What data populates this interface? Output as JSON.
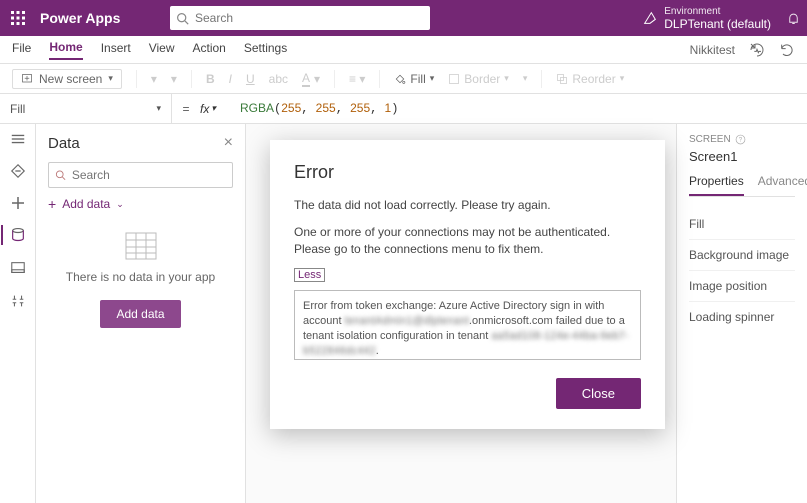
{
  "topbar": {
    "brand": "Power Apps",
    "search_placeholder": "Search",
    "env_label": "Environment",
    "env_name": "DLPTenant (default)"
  },
  "tabs": {
    "items": [
      "File",
      "Home",
      "Insert",
      "View",
      "Action",
      "Settings"
    ],
    "active": "Home",
    "user": "Nikkitest"
  },
  "toolbar": {
    "new_screen": "New screen",
    "fill": "Fill",
    "border": "Border",
    "reorder": "Reorder"
  },
  "fx": {
    "property": "Fill",
    "fx_label": "fx",
    "fn": "RGBA",
    "args": [
      "255",
      "255",
      "255",
      "1"
    ]
  },
  "datapanel": {
    "title": "Data",
    "search_placeholder": "Search",
    "add_link": "Add data",
    "empty_msg": "There is no data in your app",
    "add_btn": "Add data"
  },
  "inspector": {
    "section": "SCREEN",
    "name": "Screen1",
    "tabs": [
      "Properties",
      "Advanced"
    ],
    "props": [
      "Fill",
      "Background image",
      "Image position",
      "Loading spinner"
    ]
  },
  "modal": {
    "title": "Error",
    "line1": "The data did not load correctly. Please try again.",
    "line2": "One or more of your connections may not be authenticated. Please go to the connections menu to fix them.",
    "less": "Less",
    "detail_pre": "Error from token exchange: Azure Active Directory sign in with account ",
    "detail_red1": "tenantAdmin1@dlptenant",
    "detail_mid": ".onmicrosoft.com failed due to a tenant isolation configuration in tenant ",
    "detail_red2": "aa5ad108-124e-44ba-9eb7-b522846dc442",
    "detail_post": ".",
    "close": "Close"
  }
}
